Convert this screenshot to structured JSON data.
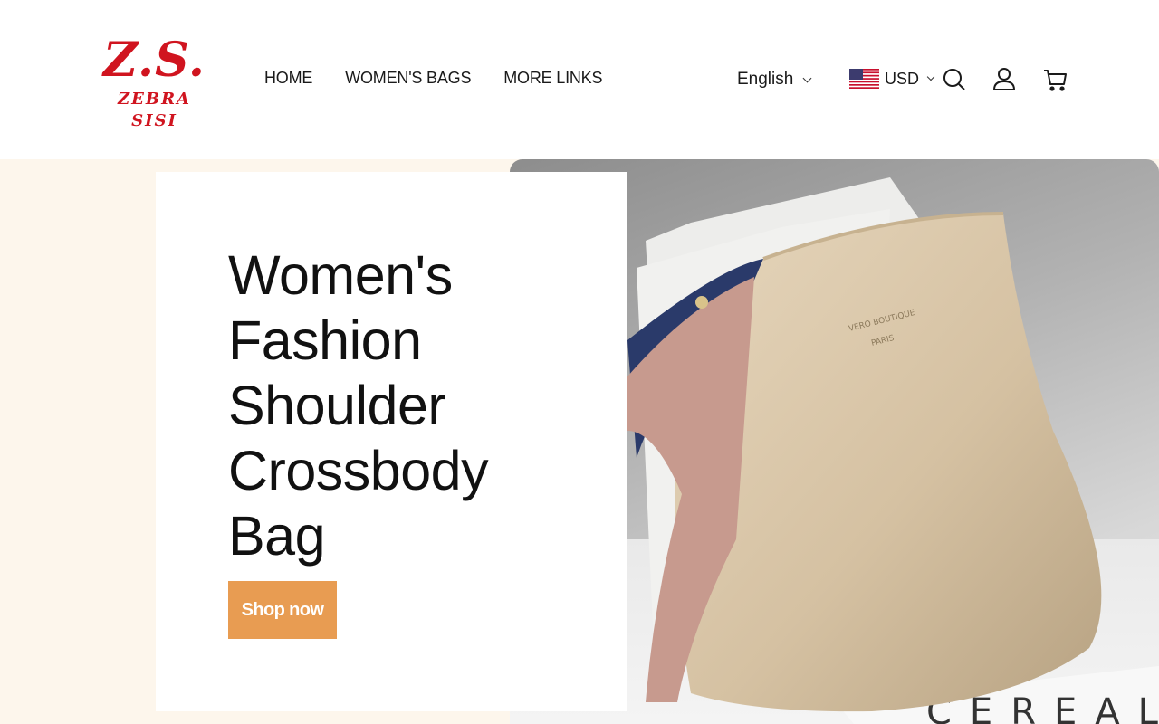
{
  "brand": {
    "mark": "Z.S.",
    "wordmark": "ZEBRA SISI",
    "color": "#d0141f"
  },
  "nav": {
    "items": [
      "HOME",
      "WOMEN'S BAGS",
      "MORE LINKS"
    ]
  },
  "locale": {
    "language": "English",
    "currency": "USD",
    "flag_icon": "us-flag-icon"
  },
  "header_icons": [
    "search-icon",
    "account-icon",
    "cart-icon"
  ],
  "hero": {
    "title": "Women's Fashion Shoulder Crossbody Bag",
    "cta_label": "Shop now",
    "cta_color": "#e89c52",
    "background_color": "#fdf6ec",
    "image_print": "CEREAL"
  }
}
